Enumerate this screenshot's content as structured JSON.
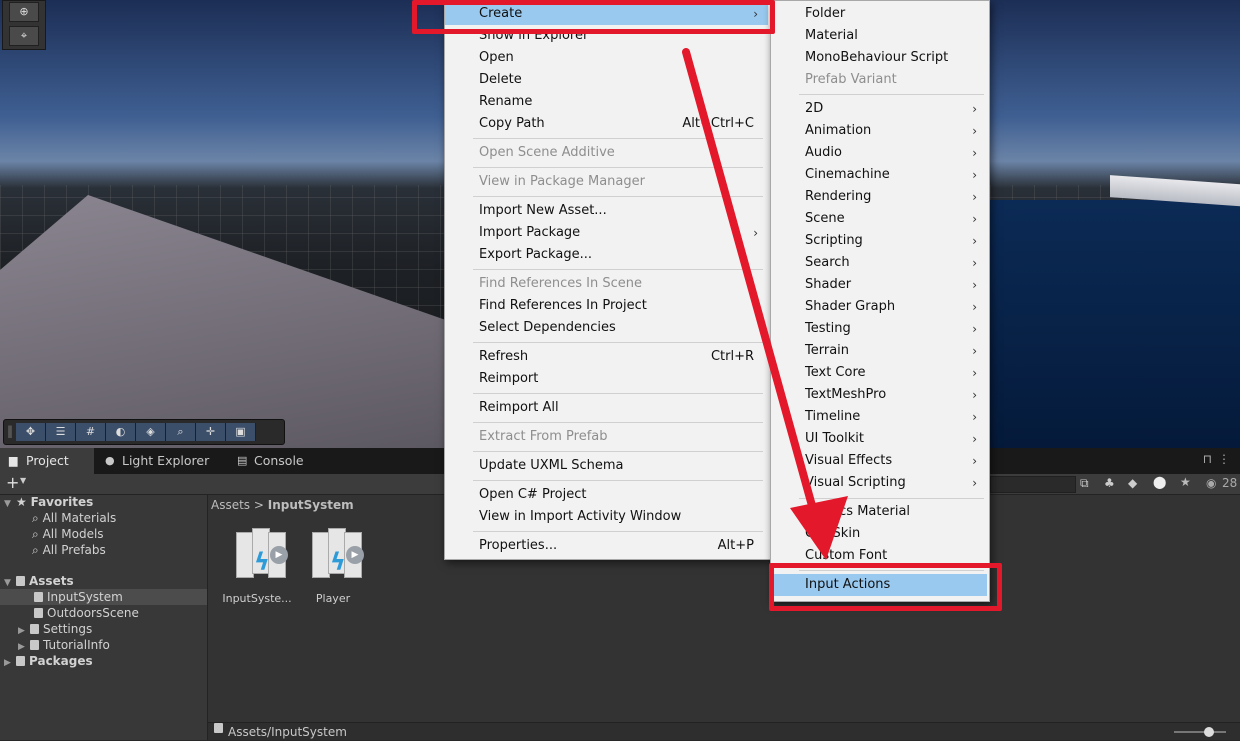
{
  "scene": {
    "bottom_tools": [
      "move-tool",
      "transform-tool",
      "grid-tool",
      "sphere-tool",
      "layers-tool",
      "search-tool",
      "snap-tool",
      "camera-tool"
    ]
  },
  "tabs": [
    {
      "label": "Project",
      "icon": "folder-icon"
    },
    {
      "label": "Light Explorer",
      "icon": "bulb-icon"
    },
    {
      "label": "Console",
      "icon": "console-icon"
    }
  ],
  "toolbar": {
    "add_label": "+",
    "count": "28"
  },
  "tree": {
    "favorites": {
      "label": "Favorites",
      "items": [
        "All Materials",
        "All Models",
        "All Prefabs"
      ]
    },
    "assets": {
      "label": "Assets",
      "items": [
        "InputSystem",
        "OutdoorsScene",
        "Settings",
        "TutorialInfo"
      ]
    },
    "packages": "Packages"
  },
  "breadcrumb": {
    "root": "Assets",
    "separator": ">",
    "current": "InputSystem"
  },
  "assets": [
    {
      "label": "InputSyste..."
    },
    {
      "label": "Player"
    }
  ],
  "path": "Assets/InputSystem",
  "context_menu": {
    "create": "Create",
    "show_in_explorer": "Show in Explorer",
    "open": "Open",
    "delete": "Delete",
    "rename": "Rename",
    "copy_path": "Copy Path",
    "copy_path_shortcut": "Alt+Ctrl+C",
    "open_scene_additive": "Open Scene Additive",
    "view_in_package_manager": "View in Package Manager",
    "import_new_asset": "Import New Asset...",
    "import_package": "Import Package",
    "export_package": "Export Package...",
    "find_refs_scene": "Find References In Scene",
    "find_refs_project": "Find References In Project",
    "select_dependencies": "Select Dependencies",
    "refresh": "Refresh",
    "refresh_shortcut": "Ctrl+R",
    "reimport": "Reimport",
    "reimport_all": "Reimport All",
    "extract_from_prefab": "Extract From Prefab",
    "update_uxml": "Update UXML Schema",
    "open_csharp": "Open C# Project",
    "view_import_activity": "View in Import Activity Window",
    "properties": "Properties...",
    "properties_shortcut": "Alt+P"
  },
  "create_menu": {
    "folder": "Folder",
    "material": "Material",
    "monobehaviour": "MonoBehaviour Script",
    "prefab_variant": "Prefab Variant",
    "submenus": [
      "2D",
      "Animation",
      "Audio",
      "Cinemachine",
      "Rendering",
      "Scene",
      "Scripting",
      "Search",
      "Shader",
      "Shader Graph",
      "Testing",
      "Terrain",
      "Text Core",
      "TextMeshPro",
      "Timeline",
      "UI Toolkit",
      "Visual Effects",
      "Visual Scripting"
    ],
    "physics_material": "Physics Material",
    "gui_skin": "GUI Skin",
    "custom_font": "Custom Font",
    "input_actions": "Input Actions"
  },
  "colors": {
    "highlight": "#99c9ef",
    "annotation": "#e3182b"
  }
}
